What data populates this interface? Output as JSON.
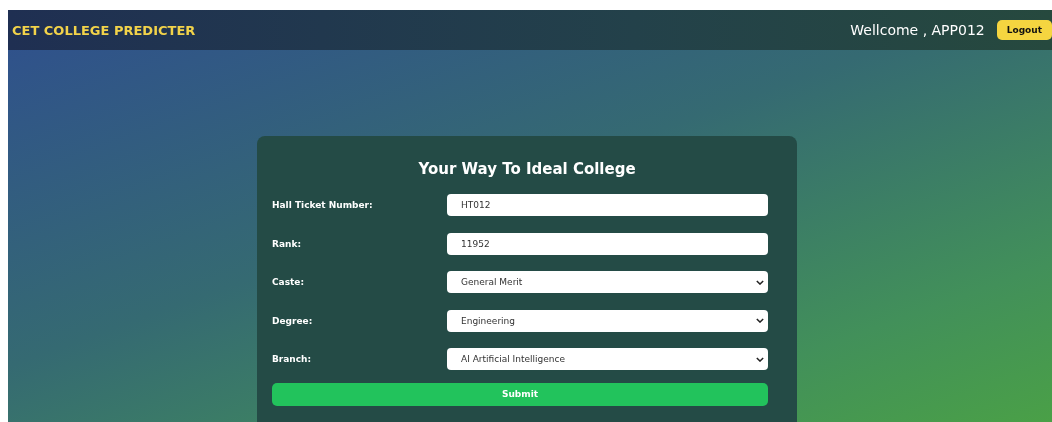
{
  "navbar": {
    "brand": "CET COLLEGE PREDICTER",
    "welcome": "Wellcome , APP012",
    "logout": "Logout"
  },
  "form": {
    "title": "Your Way To Ideal College",
    "fields": [
      {
        "label": "Hall Ticket Number:",
        "kind": "text",
        "value": "HT012"
      },
      {
        "label": "Rank:",
        "kind": "text",
        "value": "11952"
      },
      {
        "label": "Caste:",
        "kind": "select",
        "value": "General Merit"
      },
      {
        "label": "Degree:",
        "kind": "select",
        "value": "Engineering"
      },
      {
        "label": "Branch:",
        "kind": "select",
        "value": "AI Artificial Intelligence"
      }
    ],
    "submit": "Submit"
  }
}
